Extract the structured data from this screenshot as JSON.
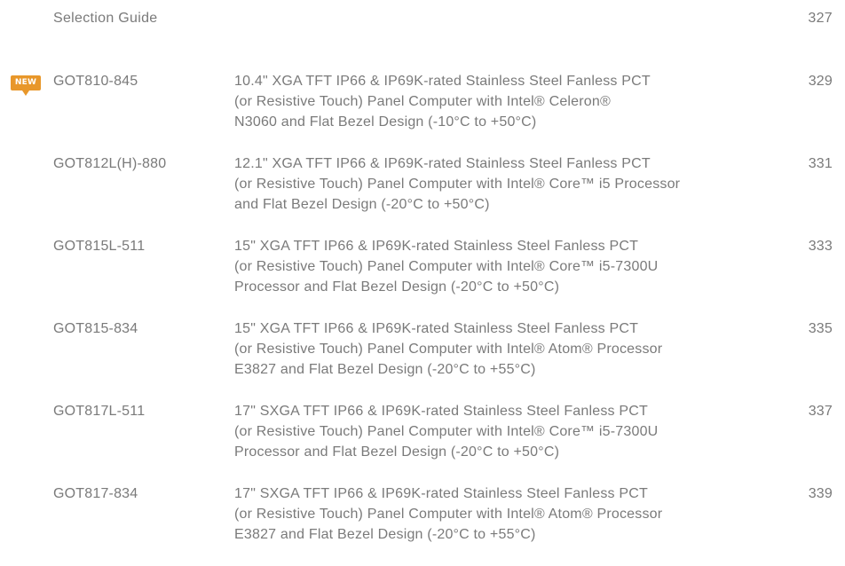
{
  "guide": {
    "title": "Selection Guide",
    "page": "327"
  },
  "badge": {
    "label": "NEW",
    "color": "#e8972a"
  },
  "entries": [
    {
      "model": "GOT810-845",
      "lines": [
        "10.4\" XGA TFT IP66 & IP69K-rated Stainless Steel Fanless PCT",
        "(or Resistive Touch) Panel Computer with Intel® Celeron®",
        "N3060 and Flat Bezel Design (-10°C to +50°C)"
      ],
      "page": "329"
    },
    {
      "model": "GOT812L(H)-880",
      "lines": [
        "12.1\" XGA TFT IP66 & IP69K-rated Stainless Steel Fanless PCT",
        "(or Resistive Touch) Panel Computer with Intel® Core™ i5 Processor",
        "and Flat Bezel Design (-20°C to +50°C)"
      ],
      "page": "331"
    },
    {
      "model": "GOT815L-511",
      "lines": [
        "15\" XGA TFT IP66 & IP69K-rated Stainless Steel Fanless PCT",
        "(or Resistive Touch) Panel Computer with Intel® Core™ i5-7300U",
        "Processor and Flat Bezel Design (-20°C to +50°C)"
      ],
      "page": "333"
    },
    {
      "model": "GOT815-834",
      "lines": [
        "15\" XGA TFT IP66 & IP69K-rated Stainless Steel Fanless PCT",
        "(or Resistive Touch) Panel Computer with Intel® Atom® Processor",
        "E3827 and Flat Bezel Design (-20°C to +55°C)"
      ],
      "page": "335"
    },
    {
      "model": "GOT817L-511",
      "lines": [
        "17\" SXGA TFT IP66 & IP69K-rated Stainless Steel Fanless PCT",
        "(or Resistive Touch) Panel Computer with Intel® Core™ i5-7300U",
        "Processor and Flat Bezel Design (-20°C to +50°C)"
      ],
      "page": "337"
    },
    {
      "model": "GOT817-834",
      "lines": [
        "17\" SXGA TFT IP66 & IP69K-rated Stainless Steel Fanless PCT",
        "(or Resistive Touch) Panel Computer with Intel® Atom® Processor",
        "E3827 and Flat Bezel Design (-20°C to +55°C)"
      ],
      "page": "339"
    }
  ]
}
